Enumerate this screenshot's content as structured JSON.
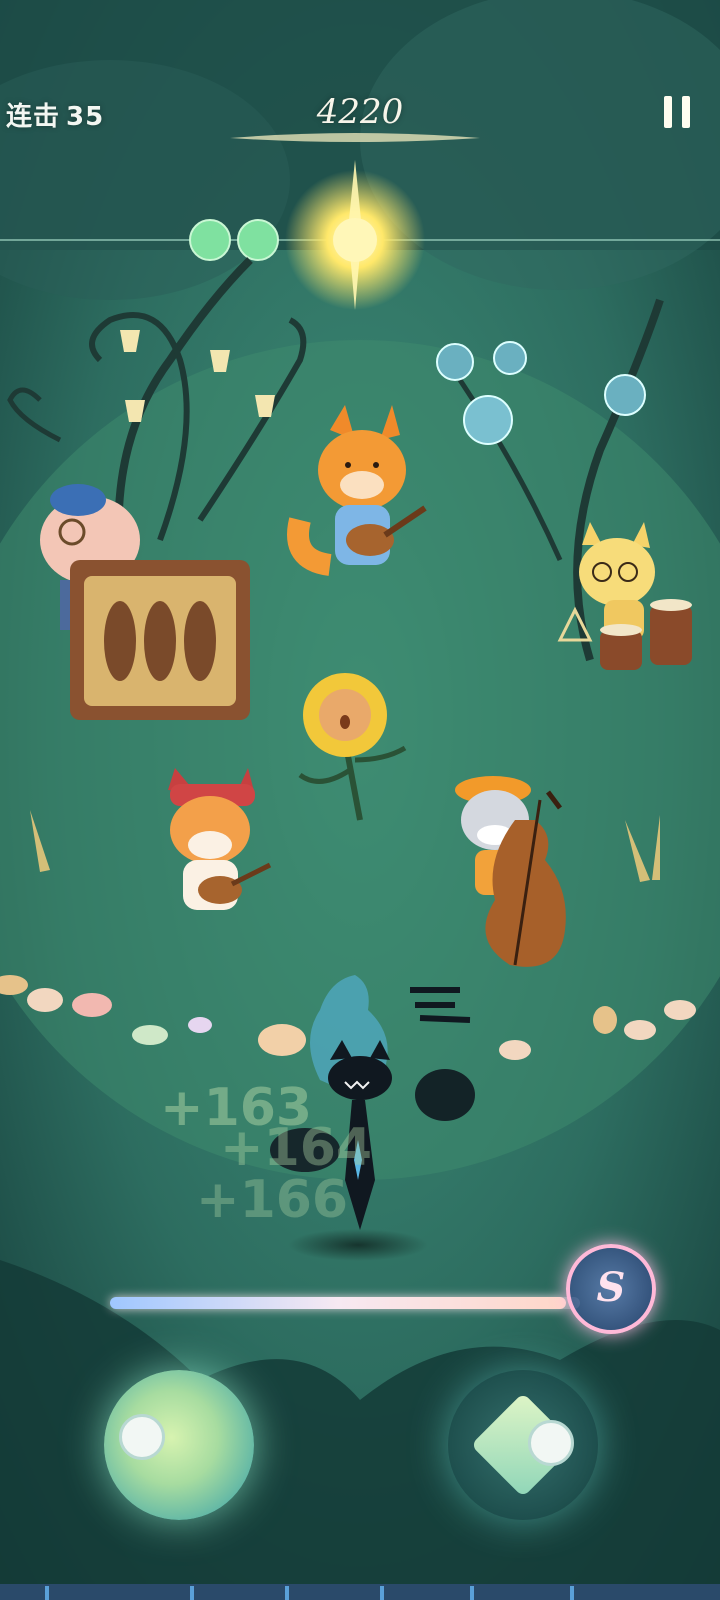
{
  "hud": {
    "combo_label": "连击",
    "combo_count": "35",
    "score": "4220",
    "pause": "pause-icon"
  },
  "hit_popups": [
    "+163",
    "+164",
    "+166"
  ],
  "progress": {
    "fraction": 0.97
  },
  "bonus_orb": {
    "label": "S"
  },
  "band": [
    "pig-piano",
    "fox-guitar",
    "cat-drums",
    "sunflower-singer",
    "corgi-ukulele",
    "schnauzer-double-bass",
    "shadow-cat-character"
  ],
  "colors": {
    "background": "#2c6a5c",
    "accent_yellow": "#ffe86a",
    "note_green": "#7fe1a0",
    "progress_pink": "#ffb9d8"
  }
}
